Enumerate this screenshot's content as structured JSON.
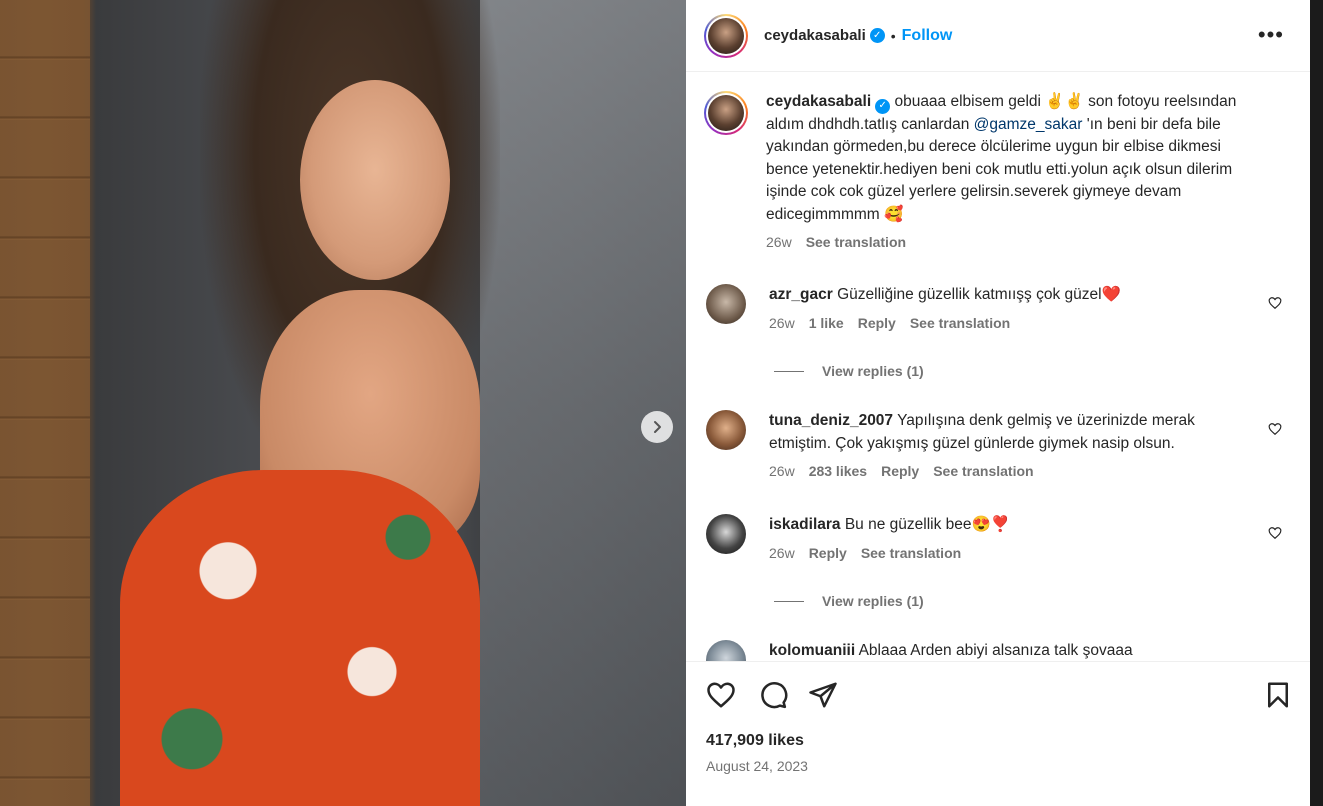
{
  "post": {
    "author": "ceydakasabali",
    "dot": "•",
    "follow_label": "Follow",
    "more_label": "•••"
  },
  "caption": {
    "username": "ceydakasabali",
    "text_before_mention": "obuaaa elbisem geldi ✌️✌️ son fotoyu reelsından aldım dhdhdh.tatlış canlardan ",
    "mention": "@gamze_sakar",
    "text_after_mention": " 'ın beni bir defa bile yakından görmeden,bu derece ölcülerime uygun bir elbise dikmesi bence yetenektir.hediyen beni cok mutlu etti.yolun açık olsun dilerim işinde cok cok güzel yerlere gelirsin.severek giymeye devam edicegimmmmm 🥰",
    "time": "26w",
    "see_translation": "See translation"
  },
  "comments": [
    {
      "username": "azr_gacr",
      "text": "Güzelliğine güzellik katmıışş çok güzel❤️",
      "time": "26w",
      "likes": "1 like",
      "reply": "Reply",
      "see_translation": "See translation",
      "view_replies": "View replies (1)"
    },
    {
      "username": "tuna_deniz_2007",
      "text": "Yapılışına denk gelmiş ve üzerinizde merak etmiştim. Çok yakışmış güzel günlerde giymek nasip olsun.",
      "time": "26w",
      "likes": "283 likes",
      "reply": "Reply",
      "see_translation": "See translation"
    },
    {
      "username": "iskadilara",
      "text": "Bu ne güzellik bee😍❣️",
      "time": "26w",
      "reply": "Reply",
      "see_translation": "See translation",
      "view_replies": "View replies (1)"
    },
    {
      "username": "kolomuaniii",
      "text": "Ablaaa Arden abiyi alsanıza talk şovaaa"
    }
  ],
  "footer": {
    "likes": "417,909 likes",
    "date": "August 24, 2023"
  },
  "icons": {
    "verified": "verified-badge-icon",
    "like": "heart-icon",
    "comment": "comment-bubble-icon",
    "share": "send-icon",
    "save": "bookmark-icon",
    "next": "chevron-right-icon"
  },
  "colors": {
    "accent": "#0095f6",
    "mention": "#00376b",
    "muted": "#737373",
    "text": "#262626"
  }
}
